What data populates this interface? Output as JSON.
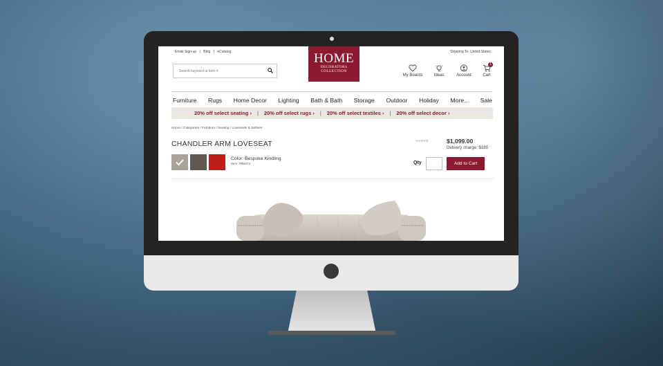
{
  "colors": {
    "brand": "#8b1a30",
    "promo_bg": "#ebe7e2"
  },
  "header": {
    "top_links": [
      "Email Sign-up",
      "|",
      "Blog",
      "|",
      "eCatalog"
    ],
    "shipping": "Shipping To: United States",
    "search_placeholder": "Search keyword or item #",
    "logo": {
      "main": "HOME",
      "line1": "DECORATORS",
      "line2": "COLLECTION"
    },
    "utility": {
      "boards": "My Boards",
      "ideas": "Ideas",
      "account": "Account",
      "cart": "Cart",
      "cart_count": "1"
    }
  },
  "nav": [
    "Furniture",
    "Rugs",
    "Home Decor",
    "Lighting",
    "Bath & Bath",
    "Storage",
    "Outdoor",
    "Holiday",
    "More...",
    "Sale"
  ],
  "promos": [
    "20% off select seating",
    "20% off select rugs",
    "20% off select textiles",
    "20% off select decor"
  ],
  "promo_arrow": "›",
  "promo_sep": "|",
  "breadcrumb": "Home / Categories / Furniture / Seating / Loveseats & Settees",
  "product": {
    "title": "CHANDLER ARM LOVESEAT",
    "color_label": "Color: Bespoke Kindling",
    "item_number": "Item: #55373",
    "rating": 0,
    "stars": "♥♥♥♥♥",
    "price": "$1,099.00",
    "delivery": "Delivery charge: $180",
    "qty_label": "Qty",
    "add_to_cart": "Add to Cart",
    "swatches": [
      {
        "name": "Bespoke Kindling",
        "color": "#a9a39c",
        "selected": true
      },
      {
        "name": "Charcoal",
        "color": "#5f5750"
      },
      {
        "name": "Red",
        "color": "#bb1f1a"
      }
    ]
  }
}
